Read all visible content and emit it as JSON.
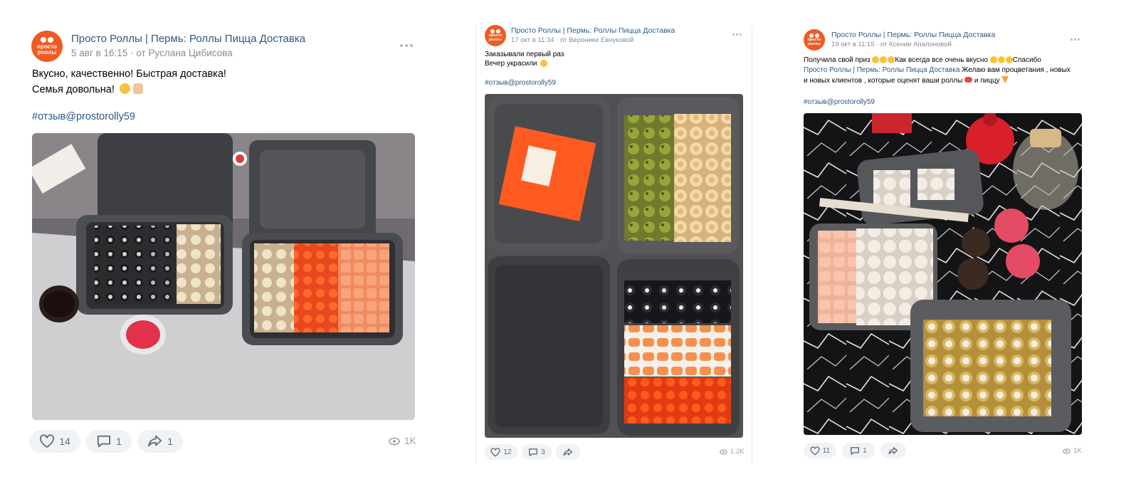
{
  "posts": [
    {
      "group": "Просто Роллы | Пермь: Роллы Пицца Доставка",
      "avatar_text": [
        "просто",
        "роллы"
      ],
      "date": "5 авг в 16:15",
      "author": "от Руслана Цибисова",
      "lines": [
        "Вкусно, качественно! Быстрая доставка!",
        "Семья довольна!"
      ],
      "hashtag": "#отзыв@prostorolly59",
      "likes": "14",
      "comments": "1",
      "shares": "1",
      "views": "1K"
    },
    {
      "group": "Просто Роллы | Пермь: Роллы Пицца Доставка",
      "avatar_text": [
        "просто",
        "роллы"
      ],
      "date": "17 окт в 11:34",
      "author": "от Вероники Евнуковой",
      "lines": [
        "Заказывали первый раз",
        "Вечер украсили"
      ],
      "hashtag": "#отзыв@prostorolly59",
      "likes": "12",
      "comments": "3",
      "views": "1.2K"
    },
    {
      "group": "Просто Роллы | Пермь: Роллы Пицца Доставка",
      "avatar_text": [
        "просто",
        "роллы"
      ],
      "date": "19 окт в 11:15",
      "author": "от Ксении Апалоновой",
      "line1a": "Получила свой приз",
      "line1b": "Как всегда все очень вкусно",
      "line1c": "Спасибо",
      "line2_link": "Просто Роллы | Пермь: Роллы Пицца Доставка",
      "line2_rest": "Желаю вам процветания , новых",
      "line3": "и новых клиентов , которые оценят ваши роллы",
      "line3b": "и пиццу",
      "hashtag": "#отзыв@prostorolly59",
      "likes": "11",
      "comments": "1",
      "views": "1K"
    }
  ],
  "colors": {
    "brand": "#f15a22",
    "link": "#2a5885",
    "meta": "#818c99",
    "pill": "#f0f2f5"
  }
}
